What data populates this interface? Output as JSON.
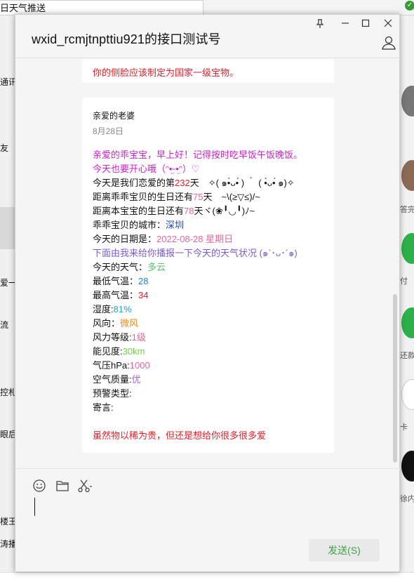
{
  "background": {
    "top_tab_label": "日天气推送",
    "left_items": [
      "通讯",
      "友",
      "爱一",
      "流",
      "控札",
      "眼后",
      "楼王",
      "涛播"
    ],
    "right_items": [
      "答完",
      "付",
      "还款",
      "卡",
      "徐内"
    ]
  },
  "window": {
    "title": "wxid_rcmjtnpttiu921的接口测试号",
    "pin_icon": "pin-icon",
    "minimize_icon": "minimize-icon",
    "maximize_icon": "maximize-icon",
    "close_icon": "close-icon",
    "profile_icon": "person-icon"
  },
  "messages": {
    "previous_line": "你的侧脸应该制定为国家一级宝物。",
    "card": {
      "sender": "亲爱的老婆",
      "date": "8月28日",
      "greeting_1": "亲爱的乖宝宝，早上好！记得按时吃早饭午饭晚饭。",
      "greeting_2": "今天也要开心哦（ᵔ•̤ᵕ•̤ᵔ）♡",
      "love_prefix": "今天是我们恋爱的第",
      "love_days": "232",
      "love_suffix": "天　✧( ๑•̀ᴗ•́ ) ｀ ( •̀ᴗ•́ ๑)✧",
      "her_bday_prefix": "距离乖乖宝贝的生日还有",
      "her_bday_days": "75",
      "her_bday_suffix": "天　~\\(≥▽≤)/~",
      "my_bday_prefix": "距离本宝宝的生日还有",
      "my_bday_days": "78",
      "my_bday_suffix": "天ヾ(❀╹◡╹)ﾉ~",
      "city_prefix": "乖乖宝贝的城市：",
      "city": "深圳",
      "date_prefix": "今天的日期是：",
      "date_value": "2022-08-28  星期日",
      "report_line": "下面由我来给你播报一下今天的天气状况 (๑`･ᴗ･´๑)",
      "weather_label": "今天的天气：",
      "weather": "多云",
      "low_label": "最低气温：",
      "low": "28",
      "high_label": "最高气温：",
      "high": "34",
      "humidity_label": "湿度:",
      "humidity": "81%",
      "wind_label": "风向：",
      "wind": "微风",
      "wind_level_label": "风力等级:",
      "wind_level": "1级",
      "visibility_label": "能见度:",
      "visibility": "30km",
      "pressure_label": "气压hPa:",
      "pressure": "1000",
      "air_label": "空气质量:",
      "air": "优",
      "warning_label": "预警类型:",
      "message_label": "寄言:",
      "closing": "虽然物以稀为贵，但还是想给你很多很多爱"
    }
  },
  "toolbar": {
    "emoji_icon": "emoji-icon",
    "folder_icon": "folder-icon",
    "scissors_icon": "scissors-icon"
  },
  "send_label": "发送(S)",
  "colors": {
    "red": "#e0202a",
    "magenta": "#cc22cc",
    "pink": "#e8649c",
    "blue": "#1f7fe0",
    "purple": "#7a5ccc",
    "green": "#5cc070",
    "orange": "#f08a24",
    "lime": "#6fd14a",
    "send_green": "#3fa14a"
  }
}
